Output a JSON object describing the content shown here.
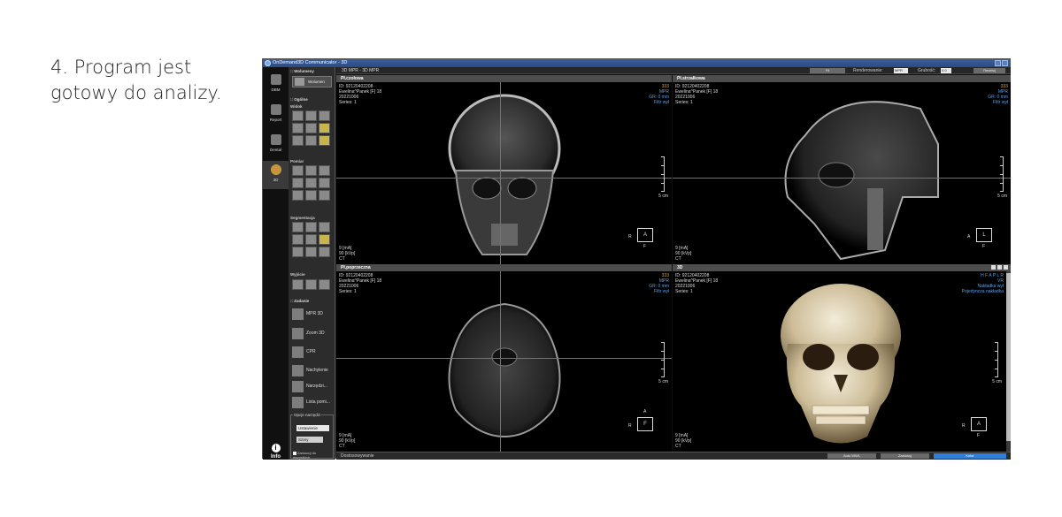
{
  "caption": {
    "line1": "4. Program jest",
    "line2": "gotowy do analizy."
  },
  "app": {
    "title": "OnDemand3D Communicator - 3D"
  },
  "nav": {
    "dbm": "DBM",
    "report": "Report",
    "dental": "Dental",
    "threeD": "3D",
    "info": "Info"
  },
  "panel": {
    "wolumeny_header": ":: Wolumeny",
    "wolumen_btn": "Wolumen",
    "ogolne_header": ":: Ogólne",
    "widok": "Widok",
    "pomiar": "Pomiar",
    "segmentacja": "Segmentacja",
    "wyjscie": "Wyjście",
    "zadanie_header": ":: Zadanie",
    "tasks": [
      "MPR 3D",
      "Zoom 3D",
      "CPR",
      "Nachylenie",
      "Narzędzi...",
      "Lista pomi..."
    ],
    "opcje_title": "Opcje narzędzi",
    "ustawienie": "Ustawienie",
    "szary": "Szary",
    "checkbox_label": "Zamocuj do wszystkich"
  },
  "toolbar": {
    "mode": "3D MPR - 3D MPR",
    "fit": "Fit",
    "render_label": "Renderowanie:",
    "render_value": "MPR",
    "thickness_label": "Grubość:",
    "thickness_value": "0.0",
    "reset": "Resetuj"
  },
  "panes": {
    "coronal": {
      "title": "Pł.czołowa",
      "id": "ID: 92120402208",
      "name": "Ewelina^Panek [F] 18",
      "date": "20221006",
      "series": "Series: 1",
      "num": "333",
      "mode": "MPR",
      "thickness": "GR: 0 mm",
      "filter": "Filtr wył",
      "ma": "9 [mA]",
      "kvp": "90 [kVp]",
      "ct": "CT",
      "scale": "5 cm",
      "orient_left": "R",
      "orient_box": "A",
      "orient_bottom": "F"
    },
    "sagittal": {
      "title": "Pł.strzałkowa",
      "id": "ID: 92120402208",
      "name": "Ewelina^Panek [F] 18",
      "date": "20221006",
      "series": "Series: 1",
      "num": "333",
      "mode": "MPR",
      "thickness": "GR: 0 mm",
      "filter": "Filtr wył",
      "ma": "9 [mA]",
      "kvp": "90 [kVp]",
      "ct": "CT",
      "scale": "5 cm",
      "orient_left": "A",
      "orient_box": "L",
      "orient_bottom": "F"
    },
    "axial": {
      "title": "Pł.poprzeczna",
      "id": "ID: 92120402208",
      "name": "Ewelina^Panek [F] 18",
      "date": "20221006",
      "series": "Series: 1",
      "num": "333",
      "mode": "MPR",
      "thickness": "GR: 0 mm",
      "filter": "Filtr wył",
      "ma": "9 [mA]",
      "kvp": "90 [kVp]",
      "ct": "CT",
      "scale": "5 cm",
      "orient_top": "A",
      "orient_left": "R",
      "orient_box": "F"
    },
    "threeD": {
      "title": "3D",
      "id": "ID: 92120402208",
      "name": "Ewelina^Panek [F] 18",
      "date": "20221006",
      "series": "Series: 1",
      "dirs": "H F A P L R",
      "mode": "VR",
      "overlay": "Nakładka wył",
      "single": "Pojedyncza nakładka",
      "ma": "9 [mA]",
      "kvp": "90 [kVp]",
      "ct": "CT",
      "scale": "5 cm",
      "orient_left": "R",
      "orient_box": "A",
      "orient_bottom": "F"
    }
  },
  "bottom": {
    "label": "Dostosowywanie",
    "auto_wwl": "Auto WWL",
    "zastosuj": "Zastosuj",
    "kolor": "Kolor"
  },
  "colors": {
    "accent": "#2f7fd8",
    "crosshair": "#3d7fc4",
    "annotation": "#5aa0e8",
    "number": "#d6a23a"
  }
}
